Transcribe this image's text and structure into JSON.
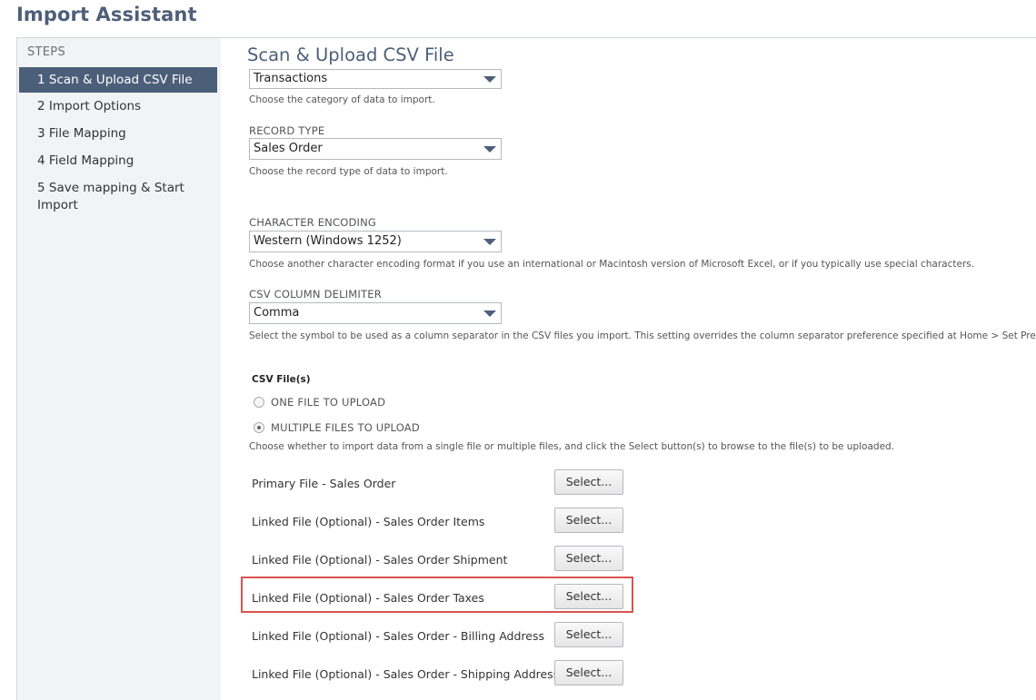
{
  "app": {
    "title": "Import Assistant"
  },
  "sidebar": {
    "heading": "STEPS",
    "steps": [
      {
        "label": "1 Scan & Upload CSV File",
        "active": true
      },
      {
        "label": "2 Import Options",
        "active": false
      },
      {
        "label": "3 File Mapping",
        "active": false
      },
      {
        "label": "4 Field Mapping",
        "active": false
      },
      {
        "label": "5 Save mapping & Start Import",
        "active": false
      }
    ]
  },
  "main": {
    "title": "Scan & Upload CSV File",
    "import_type": {
      "value": "Transactions",
      "help": "Choose the category of data to import."
    },
    "record_type": {
      "label": "RECORD TYPE",
      "value": "Sales Order",
      "help": "Choose the record type of data to import."
    },
    "encoding": {
      "label": "CHARACTER ENCODING",
      "value": "Western (Windows 1252)",
      "help": "Choose another character encoding format if you use an international or Macintosh version of Microsoft Excel, or if you typically use special characters."
    },
    "delimiter": {
      "label": "CSV COLUMN DELIMITER",
      "value": "Comma",
      "help": "Select the symbol to be used as a column separator in the CSV files you import. This setting overrides the column separator preference specified at Home > Set Preferences."
    },
    "csv_files": {
      "label": "CSV File(s)",
      "options": [
        {
          "label": "ONE FILE TO UPLOAD",
          "checked": false
        },
        {
          "label": "MULTIPLE FILES TO UPLOAD",
          "checked": true
        }
      ],
      "help": "Choose whether to import data from a single file or multiple files, and click the Select button(s) to browse to the file(s) to be uploaded."
    },
    "files": [
      {
        "label": "Primary File - Sales Order",
        "button": "Select..."
      },
      {
        "label": "Linked File (Optional) - Sales Order Items",
        "button": "Select..."
      },
      {
        "label": "Linked File (Optional) - Sales Order Shipment",
        "button": "Select..."
      },
      {
        "label": "Linked File (Optional) - Sales Order Taxes",
        "button": "Select..."
      },
      {
        "label": "Linked File (Optional) - Sales Order - Billing Address",
        "button": "Select..."
      },
      {
        "label": "Linked File (Optional) - Sales Order - Shipping Address",
        "button": "Select..."
      }
    ]
  },
  "colors": {
    "accent": "#4c5f7a",
    "highlight": "#d9534f",
    "sidebar_bg": "#f2f3f4"
  }
}
